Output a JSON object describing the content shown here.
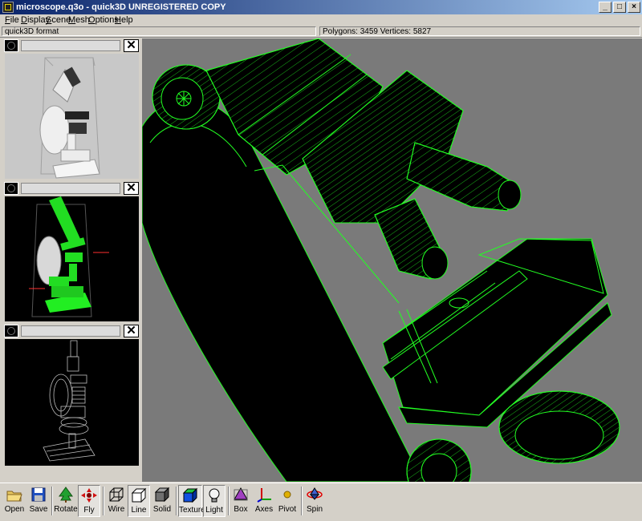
{
  "window": {
    "title": "microscope.q3o - quick3D UNREGISTERED COPY",
    "buttons": [
      "_",
      "□",
      "×"
    ]
  },
  "menu": [
    {
      "label": "File",
      "key": "F",
      "rest": "ile"
    },
    {
      "label": "Display",
      "key": "D",
      "rest": "isplay"
    },
    {
      "label": "Scene",
      "key": "S",
      "rest": "cene"
    },
    {
      "label": "Mesh",
      "key": "M",
      "rest": "esh"
    },
    {
      "label": "Options",
      "key": "O",
      "rest": "ptions"
    },
    {
      "label": "Help",
      "key": "H",
      "rest": "elp"
    }
  ],
  "status": {
    "format": "quick3D format",
    "stats": "Polygons: 3459  Vertices: 5827"
  },
  "thumbnails": [
    {
      "name": "solid-preview",
      "bg": "#c0c0c0"
    },
    {
      "name": "selected-preview",
      "bg": "#000000"
    },
    {
      "name": "wire-preview",
      "bg": "#000000"
    }
  ],
  "toolbar": {
    "open": "Open",
    "save": "Save",
    "rotate": "Rotate",
    "fly": "Fly",
    "wire": "Wire",
    "line": "Line",
    "solid": "Solid",
    "texture": "Texture",
    "light": "Light",
    "box": "Box",
    "axes": "Axes",
    "pivot": "Pivot",
    "spin": "Spin"
  },
  "colors": {
    "wire": "#22ff22",
    "viewport_bg": "#7a7a7a",
    "title_start": "#0a246a",
    "title_end": "#a6caf0"
  }
}
